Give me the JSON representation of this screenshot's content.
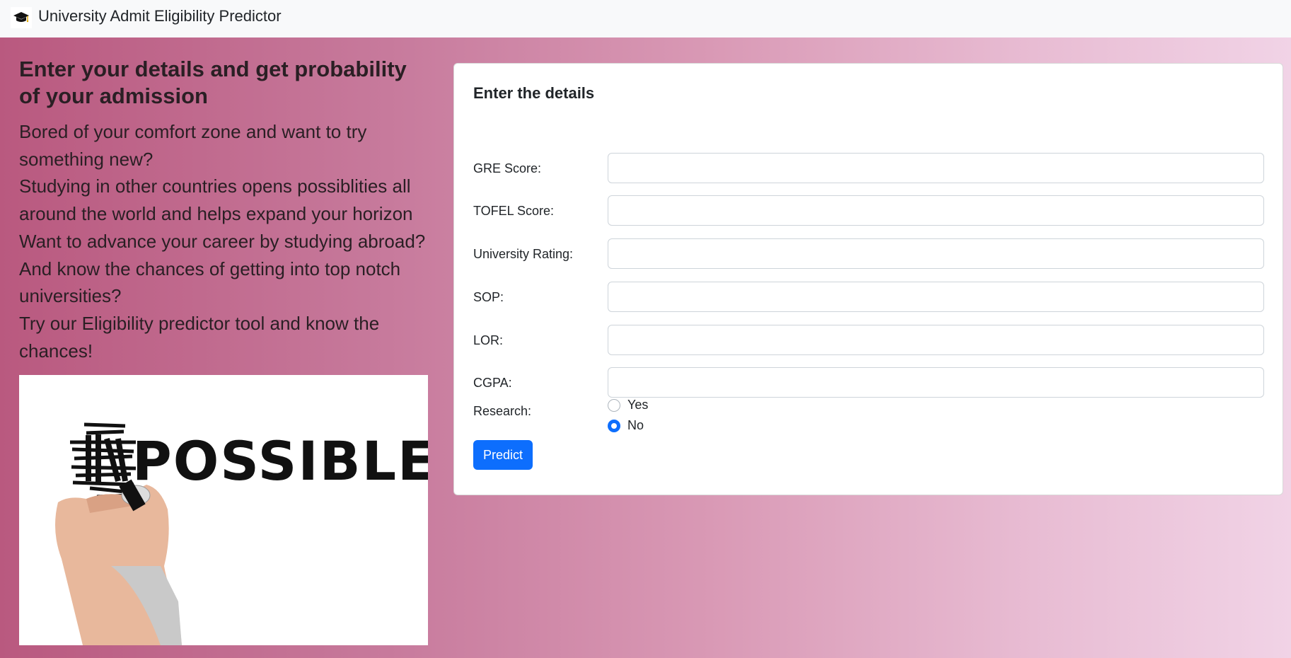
{
  "navbar": {
    "logo_icon": "graduation-cap-icon",
    "title": "University Admit Eligibility Predictor"
  },
  "hero": {
    "heading": "Enter your details and get probability of your admission",
    "lines": [
      "Bored of your comfort zone and want to try",
      "something new?",
      "Studying in other countries opens possiblities all",
      "around the world and helps expand your horizon",
      "Want to advance your career by studying abroad?",
      "And know the chances of getting into top notch",
      "universities?",
      "Try our Eligibility predictor tool and know the",
      "chances!"
    ],
    "image_text": "IMPOSSIBLE"
  },
  "form": {
    "title": "Enter the details",
    "fields": {
      "gre": {
        "label": "GRE Score:",
        "value": ""
      },
      "tofel": {
        "label": "TOFEL Score:",
        "value": ""
      },
      "rating": {
        "label": "University Rating:",
        "value": ""
      },
      "sop": {
        "label": "SOP:",
        "value": ""
      },
      "lor": {
        "label": "LOR:",
        "value": ""
      },
      "cgpa": {
        "label": "CGPA:",
        "value": ""
      }
    },
    "research": {
      "label": "Research:",
      "options": [
        "Yes",
        "No"
      ],
      "selected": "No"
    },
    "submit_label": "Predict"
  },
  "colors": {
    "accent": "#0d6efd",
    "gradient_start": "#b9597f",
    "gradient_end": "#f1d3e6"
  }
}
